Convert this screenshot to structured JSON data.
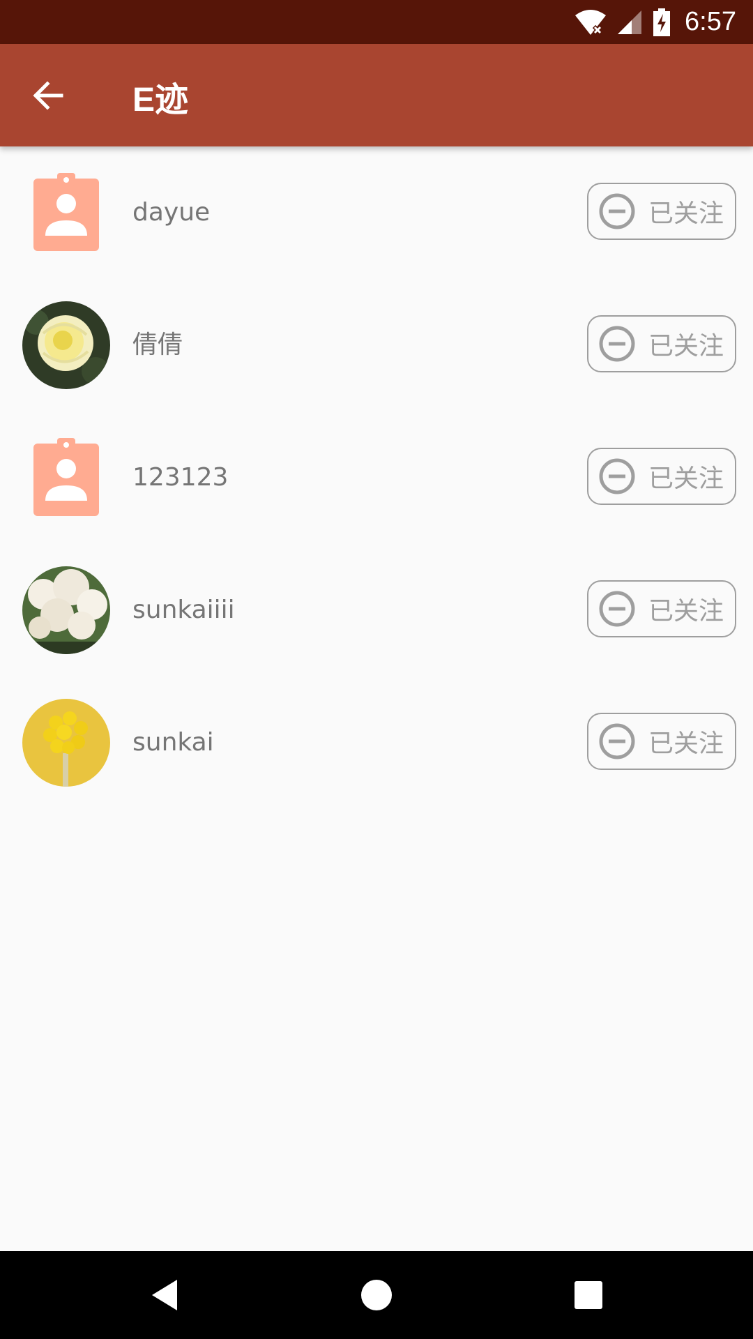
{
  "status_bar": {
    "time": "6:57"
  },
  "app_bar": {
    "title": "E迹"
  },
  "accent_color": "#a94530",
  "status_bar_color": "#561508",
  "following": [
    {
      "name": "dayue",
      "avatar": "contact-placeholder-icon",
      "button_label": "已关注"
    },
    {
      "name": "倩倩",
      "avatar": "yellow-rose-photo",
      "button_label": "已关注"
    },
    {
      "name": "123123",
      "avatar": "contact-placeholder-icon",
      "button_label": "已关注"
    },
    {
      "name": "sunkaiiii",
      "avatar": "white-blossom-photo",
      "button_label": "已关注"
    },
    {
      "name": "sunkai",
      "avatar": "yellow-billy-buttons-photo",
      "button_label": "已关注"
    }
  ],
  "nav": {
    "back": "back-triangle-icon",
    "home": "home-circle-icon",
    "recents": "recents-square-icon"
  }
}
